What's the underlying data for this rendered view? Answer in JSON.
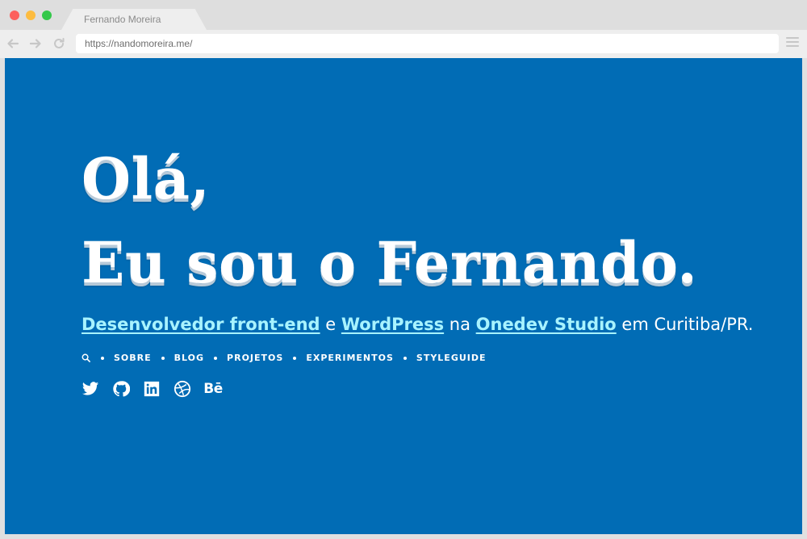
{
  "browser": {
    "tab_title": "Fernando Moreira",
    "url": "https://nandomoreira.me/"
  },
  "hero": {
    "line1": "Olá,",
    "line2": "Eu sou o Fernando."
  },
  "intro": {
    "link1": "Desenvolvedor front-end",
    "text1": " e ",
    "link2": "WordPress",
    "text2": " na ",
    "link3": "Onedev Studio",
    "text3": " em Curitiba/PR."
  },
  "nav": {
    "items": [
      "SOBRE",
      "BLOG",
      "PROJETOS",
      "EXPERIMENTOS",
      "STYLEGUIDE"
    ]
  },
  "social": {
    "icons": [
      "twitter-icon",
      "github-icon",
      "linkedin-icon",
      "dribbble-icon",
      "behance-icon"
    ],
    "behance_label": "Bē"
  },
  "colors": {
    "page_background": "#016cb5",
    "link": "#a8f3ff",
    "text": "#ffffff"
  }
}
